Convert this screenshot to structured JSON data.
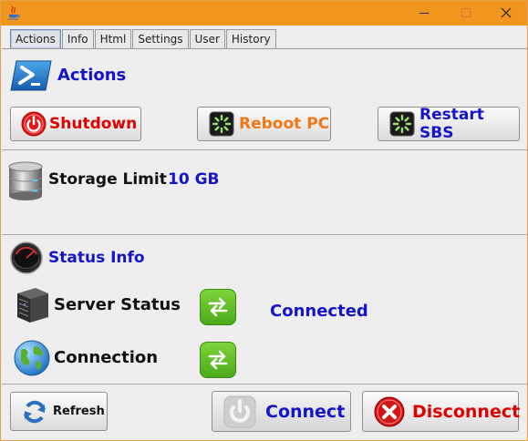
{
  "window": {
    "controls": {
      "minimize": "minimize-icon",
      "maximize": "maximize-icon",
      "close": "close-icon"
    }
  },
  "tabs": [
    {
      "label": "Actions",
      "active": true
    },
    {
      "label": "Info"
    },
    {
      "label": "Html"
    },
    {
      "label": "Settings"
    },
    {
      "label": "User"
    },
    {
      "label": "History"
    }
  ],
  "actions": {
    "title": "Actions",
    "shutdown_label": "Shutdown",
    "reboot_label": "Reboot PC",
    "restart_label": "Restart SBS"
  },
  "storage": {
    "label": "Storage Limit",
    "value": "10 GB"
  },
  "status": {
    "title": "Status Info",
    "server_label": "Server Status",
    "server_value": "Connected",
    "connection_label": "Connection"
  },
  "footer": {
    "refresh_label": "Refresh",
    "connect_label": "Connect",
    "disconnect_label": "Disconnect"
  },
  "colors": {
    "titlebar": "#f0961f",
    "blue_text": "#1414c8",
    "red_text": "#e00000",
    "orange_text": "#f07818"
  }
}
